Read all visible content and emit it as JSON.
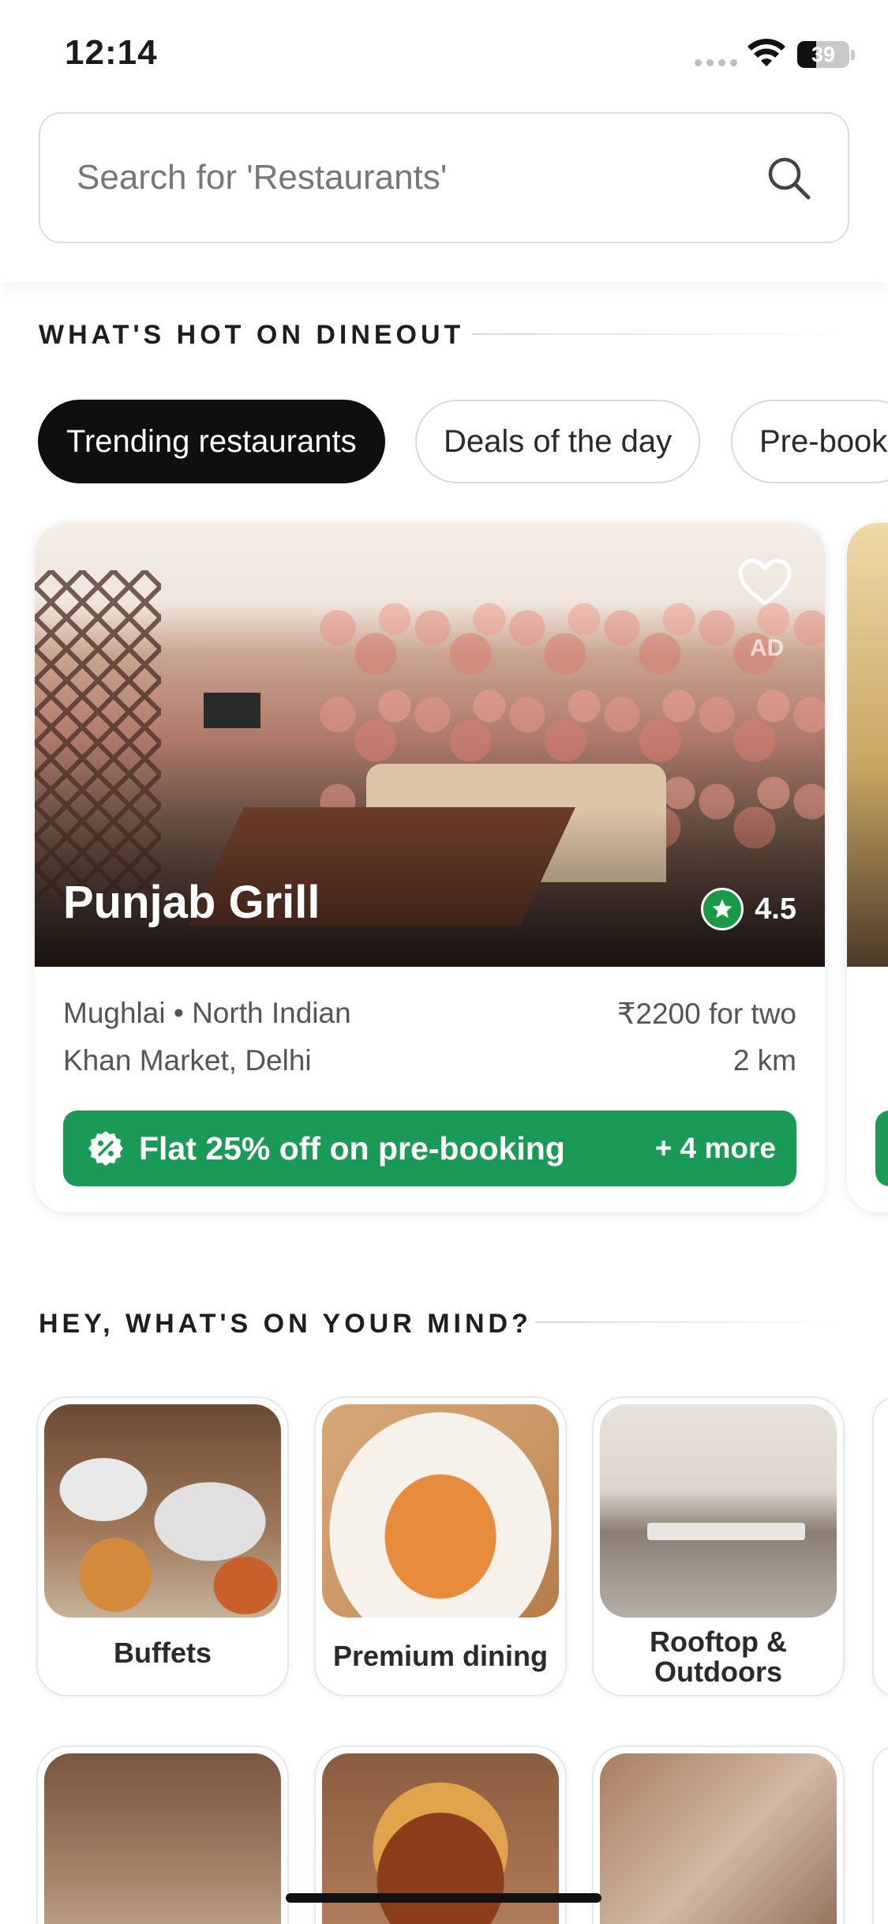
{
  "status_bar": {
    "time": "12:14",
    "battery": "39"
  },
  "search": {
    "placeholder": "Search for 'Restaurants'"
  },
  "sections": {
    "hot": "WHAT'S HOT ON DINEOUT",
    "mind": "HEY, WHAT'S ON YOUR MIND?"
  },
  "chips": [
    "Trending restaurants",
    "Deals of the day",
    "Pre-book"
  ],
  "restaurant": {
    "name": "Punjab Grill",
    "ad_label": "AD",
    "rating": "4.5",
    "cuisine": "Mughlai • North Indian",
    "price": "₹2200 for two",
    "location": "Khan Market, Delhi",
    "distance": "2 km",
    "offer": "Flat 25% off on pre-booking",
    "offer_more": "+ 4 more"
  },
  "categories": [
    {
      "label": "Buffets"
    },
    {
      "label": "Premium dining"
    },
    {
      "label": "Rooftop &\nOutdoors"
    },
    {
      "label": ""
    },
    {
      "label": ""
    },
    {
      "label": ""
    }
  ],
  "icons": {
    "search": "search-icon",
    "heart": "heart-icon",
    "star": "star-icon",
    "offer": "percent-badge-icon",
    "wifi": "wifi-icon"
  },
  "colors": {
    "accent_green": "#1b9a57",
    "rating_green": "#1a9a48",
    "chip_active": "#0f0f0f"
  }
}
